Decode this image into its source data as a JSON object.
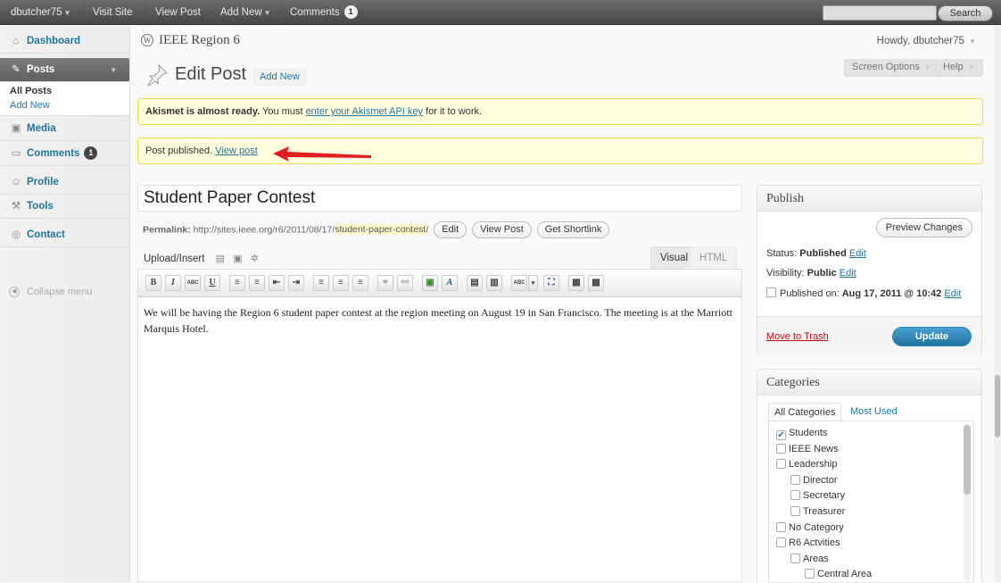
{
  "adminbar": {
    "user": "dbutcher75",
    "visit_site": "Visit Site",
    "view_post": "View Post",
    "add_new": "Add New",
    "comments": "Comments",
    "comments_count": "1",
    "search_label": "Search"
  },
  "sidebar": {
    "dashboard": "Dashboard",
    "posts": "Posts",
    "all_posts": "All Posts",
    "add_new": "Add New",
    "media": "Media",
    "comments": "Comments",
    "comments_count": "1",
    "profile": "Profile",
    "tools": "Tools",
    "contact": "Contact",
    "collapse": "Collapse menu"
  },
  "header": {
    "site_name": "IEEE Region 6",
    "howdy": "Howdy, dbutcher75",
    "screen_options": "Screen Options",
    "help": "Help",
    "page_title": "Edit Post",
    "add_new": "Add New"
  },
  "notices": {
    "akismet_bold": "Akismet is almost ready.",
    "akismet_text": " You must ",
    "akismet_link": "enter your Akismet API key",
    "akismet_end": " for it to work.",
    "published_text": "Post published. ",
    "published_link": "View post"
  },
  "editor": {
    "title": "Student Paper Contest",
    "permalink_label": "Permalink:",
    "permalink_base": " http://sites.ieee.org/r6/2011/08/17/",
    "permalink_slug": "student-paper-contest",
    "permalink_end": "/",
    "edit_btn": "Edit",
    "view_post_btn": "View Post",
    "shortlink_btn": "Get Shortlink",
    "upload_insert": "Upload/Insert",
    "tab_visual": "Visual",
    "tab_html": "HTML",
    "body": "We will be having the Region 6 student paper contest at the region meeting on August 19 in San Francisco. The meeting is at the Marriott Marquis Hotel."
  },
  "toolbar_buttons": [
    "B",
    "I",
    "ABC",
    "U",
    "≡",
    "≡",
    "⇤",
    "⇥",
    "≡",
    "≡",
    "≡",
    "⚭",
    "⚯",
    "▣",
    "A",
    "▤",
    "▥",
    "ABC",
    "▾",
    "⛶",
    "▦",
    "▩"
  ],
  "publish": {
    "title": "Publish",
    "preview": "Preview Changes",
    "status_label": "Status: ",
    "status_value": "Published",
    "visibility_label": "Visibility: ",
    "visibility_value": "Public",
    "published_label": "Published on: ",
    "published_value": "Aug 17, 2011 @ 10:42",
    "edit": "Edit",
    "trash": "Move to Trash",
    "update": "Update"
  },
  "categories": {
    "title": "Categories",
    "tab_all": "All Categories",
    "tab_used": "Most Used",
    "items": [
      {
        "label": "Students",
        "checked": true,
        "level": 0
      },
      {
        "label": "IEEE News",
        "checked": false,
        "level": 0
      },
      {
        "label": "Leadership",
        "checked": false,
        "level": 0
      },
      {
        "label": "Director",
        "checked": false,
        "level": 1
      },
      {
        "label": "Secretary",
        "checked": false,
        "level": 1
      },
      {
        "label": "Treasurer",
        "checked": false,
        "level": 1
      },
      {
        "label": "No Category",
        "checked": false,
        "level": 0
      },
      {
        "label": "R6 Actvities",
        "checked": false,
        "level": 0
      },
      {
        "label": "Areas",
        "checked": false,
        "level": 1
      },
      {
        "label": "Central Area",
        "checked": false,
        "level": 2
      }
    ]
  },
  "colors": {
    "link": "#21759b",
    "notice_bg": "#ffffe0",
    "notice_border": "#e6db55",
    "arrow": "#e02020",
    "trash": "#bc0b0b"
  }
}
